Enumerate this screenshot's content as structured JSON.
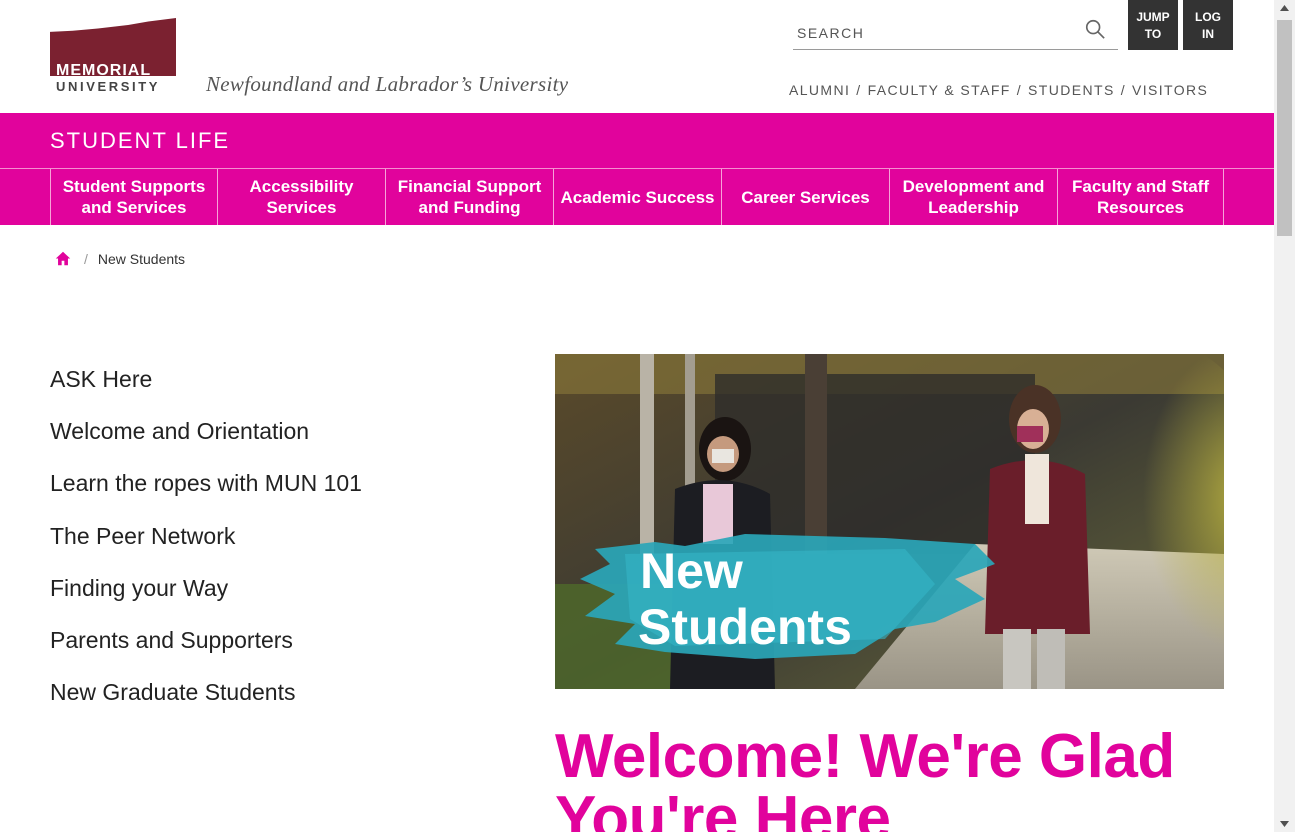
{
  "header": {
    "logo_line1": "MEMORIAL",
    "logo_line2": "UNIVERSITY",
    "tagline": "Newfoundland and Labrador’s University",
    "search_placeholder": "SEARCH",
    "jump_to_label": "JUMP TO",
    "log_in_label": "LOG IN",
    "audience_links": [
      "ALUMNI",
      "FACULTY & STAFF",
      "STUDENTS",
      "VISITORS"
    ],
    "audience_separator": "/"
  },
  "section_title": "STUDENT LIFE",
  "nav": [
    "Student Supports and Services",
    "Accessibility Services",
    "Financial Support and Funding",
    "Academic Success",
    "Career Services",
    "Development and Leadership",
    "Faculty and Staff Resources"
  ],
  "breadcrumb": {
    "separator": "/",
    "current": "New Students"
  },
  "sidebar": [
    "ASK Here",
    "Welcome and Orientation",
    "Learn the ropes with MUN 101",
    "The Peer Network",
    "Finding your Way",
    "Parents and Supporters",
    "New Graduate Students"
  ],
  "hero": {
    "overlay_line1": "New",
    "overlay_line2": "Students"
  },
  "welcome_heading": "Welcome! We're Glad You're Here",
  "colors": {
    "brand_pink": "#e1039c",
    "logo_maroon": "#7b2130",
    "dark_button": "#333333"
  }
}
